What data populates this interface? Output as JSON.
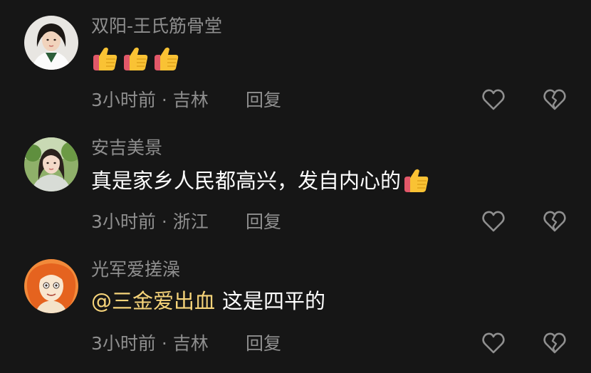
{
  "comments": [
    {
      "username": "双阳-王氏筋骨堂",
      "text": "",
      "mention": "",
      "emoji": "thumbs-up-emoji",
      "emoji_count": 3,
      "time": "3小时前",
      "location": "吉林",
      "meta": "3小时前 · 吉林",
      "reply_label": "回复"
    },
    {
      "username": "安吉美景",
      "text": "真是家乡人民都高兴，发自内心的",
      "mention": "",
      "emoji": "thumbs-up-emoji",
      "emoji_count": 1,
      "time": "3小时前",
      "location": "浙江",
      "meta": "3小时前 · 浙江",
      "reply_label": "回复"
    },
    {
      "username": "光军爱搓澡",
      "text": "这是四平的",
      "mention": "@三金爱出血",
      "emoji": "",
      "emoji_count": 0,
      "time": "3小时前",
      "location": "吉林",
      "meta": "3小时前 · 吉林",
      "reply_label": "回复"
    }
  ],
  "colors": {
    "background": "#161616",
    "username": "#8f8f8f",
    "text": "#ffffff",
    "mention": "#f6d47a",
    "icon": "#8f8f8f"
  },
  "icons": {
    "like": "heart-outline-icon",
    "dislike": "broken-heart-icon"
  }
}
